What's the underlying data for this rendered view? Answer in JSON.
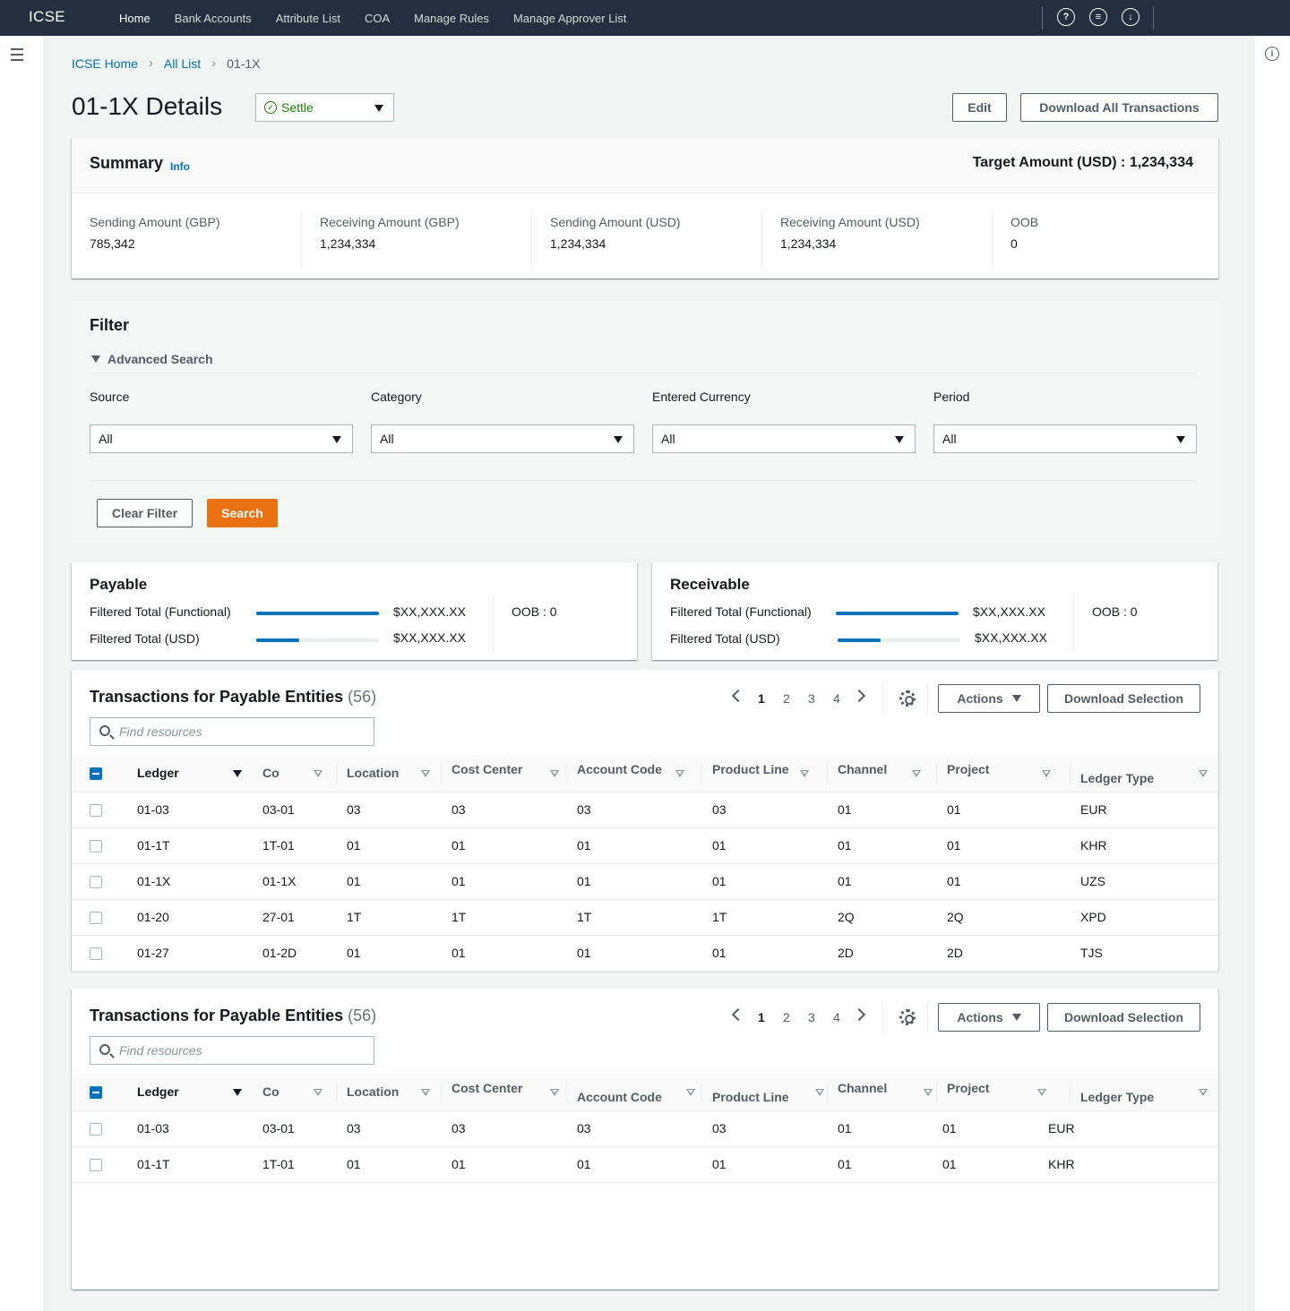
{
  "nav": {
    "brand": "ICSE",
    "items": [
      "Home",
      "Bank Accounts",
      "Attribute List",
      "COA",
      "Manage Rules",
      "Manage Approver List"
    ],
    "icons": [
      "help-icon",
      "notifications-icon",
      "settings-icon"
    ]
  },
  "breadcrumb": [
    "ICSE Home",
    "All List",
    "01-1X"
  ],
  "page": {
    "title": "01-1X Details",
    "status": "Settle",
    "edit_label": "Edit",
    "download_all_label": "Download All Transactions"
  },
  "summary": {
    "title": "Summary",
    "info": "Info",
    "target": "Target Amount (USD) : 1,234,334",
    "items": [
      {
        "label": "Sending Amount (GBP)",
        "value": "785,342"
      },
      {
        "label": "Receiving Amount (GBP)",
        "value": "1,234,334"
      },
      {
        "label": "Sending Amount (USD)",
        "value": "1,234,334"
      },
      {
        "label": "Receiving Amount (USD)",
        "value": "1,234,334"
      },
      {
        "label": "OOB",
        "value": "0"
      }
    ]
  },
  "filter": {
    "title": "Filter",
    "advanced": "Advanced Search",
    "fields": [
      {
        "label": "Source",
        "value": "All"
      },
      {
        "label": "Category",
        "value": "All"
      },
      {
        "label": "Entered Currency",
        "value": "All"
      },
      {
        "label": "Period",
        "value": "All"
      }
    ],
    "clear_label": "Clear Filter",
    "search_label": "Search"
  },
  "payable": {
    "title": "Payable",
    "functional_label": "Filtered Total (Functional)",
    "functional_value": "$XX,XXX.XX",
    "functional_progress": 1.0,
    "usd_label": "Filtered Total (USD)",
    "usd_value": "$XX,XXX.XX",
    "usd_progress": 0.35,
    "oob": "OOB : 0"
  },
  "receivable": {
    "title": "Receivable",
    "functional_label": "Filtered Total (Functional)",
    "functional_value": "$XX,XXX.XX",
    "functional_progress": 1.0,
    "usd_label": "Filtered Total (USD)",
    "usd_value": "$XX,XXX.XX",
    "usd_progress": 0.35,
    "oob": "OOB : 0"
  },
  "tables": [
    {
      "title": "Transactions for Payable Entities",
      "count": "(56)",
      "search_placeholder": "Find resources",
      "pages": [
        "1",
        "2",
        "3",
        "4"
      ],
      "current_page": "1",
      "actions_label": "Actions",
      "download_label": "Download Selection",
      "columns": [
        "Ledger",
        "Co",
        "Location",
        "Cost Center",
        "Account Code",
        "Product Line",
        "Channel",
        "Project",
        "Ledger Type"
      ],
      "rows": [
        [
          "01-03",
          "03-01",
          "03",
          "03",
          "03",
          "03",
          "01",
          "01",
          "EUR"
        ],
        [
          "01-1T",
          "1T-01",
          "01",
          "01",
          "01",
          "01",
          "01",
          "01",
          "KHR"
        ],
        [
          "01-1X",
          "01-1X",
          "01",
          "01",
          "01",
          "01",
          "01",
          "01",
          "UZS"
        ],
        [
          "01-20",
          "27-01",
          "1T",
          "1T",
          "1T",
          "1T",
          "2Q",
          "2Q",
          "XPD"
        ],
        [
          "01-27",
          "01-2D",
          "01",
          "01",
          "01",
          "01",
          "2D",
          "2D",
          "TJS"
        ]
      ]
    },
    {
      "title": "Transactions for Payable Entities",
      "count": "(56)",
      "search_placeholder": "Find resources",
      "pages": [
        "1",
        "2",
        "3",
        "4"
      ],
      "current_page": "1",
      "actions_label": "Actions",
      "download_label": "Download Selection",
      "columns": [
        "Ledger",
        "Co",
        "Location",
        "Cost Center",
        "Account Code",
        "Product Line",
        "Channel",
        "Project",
        "Ledger Type"
      ],
      "rows": [
        [
          "01-03",
          "03-01",
          "03",
          "03",
          "03",
          "03",
          "01",
          "01",
          "EUR"
        ],
        [
          "01-1T",
          "1T-01",
          "01",
          "01",
          "01",
          "01",
          "01",
          "01",
          "KHR"
        ]
      ]
    }
  ]
}
